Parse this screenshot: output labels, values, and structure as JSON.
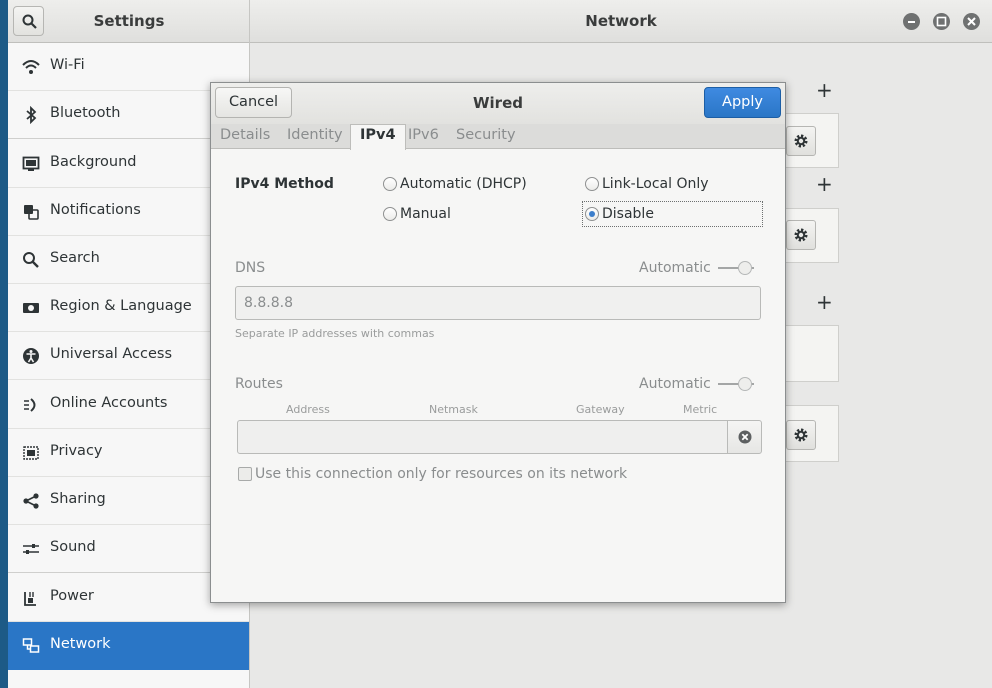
{
  "window": {
    "left_title": "Settings",
    "right_title": "Network"
  },
  "sidebar": {
    "items": [
      {
        "label": "Wi-Fi",
        "icon": "wifi-icon"
      },
      {
        "label": "Bluetooth",
        "icon": "bluetooth-icon"
      },
      {
        "label": "Background",
        "icon": "background-icon"
      },
      {
        "label": "Notifications",
        "icon": "notifications-icon"
      },
      {
        "label": "Search",
        "icon": "search-icon"
      },
      {
        "label": "Region & Language",
        "icon": "region-icon"
      },
      {
        "label": "Universal Access",
        "icon": "universal-access-icon"
      },
      {
        "label": "Online Accounts",
        "icon": "online-accounts-icon"
      },
      {
        "label": "Privacy",
        "icon": "privacy-icon"
      },
      {
        "label": "Sharing",
        "icon": "sharing-icon"
      },
      {
        "label": "Sound",
        "icon": "sound-icon"
      },
      {
        "label": "Power",
        "icon": "power-icon"
      },
      {
        "label": "Network",
        "icon": "network-icon",
        "active": true
      }
    ]
  },
  "dialog": {
    "title": "Wired",
    "cancel_label": "Cancel",
    "apply_label": "Apply",
    "tabs": [
      {
        "label": "Details"
      },
      {
        "label": "Identity"
      },
      {
        "label": "IPv4",
        "active": true
      },
      {
        "label": "IPv6"
      },
      {
        "label": "Security"
      }
    ],
    "ipv4_method_label": "IPv4 Method",
    "methods": {
      "automatic_dhcp": "Automatic (DHCP)",
      "link_local": "Link-Local Only",
      "manual": "Manual",
      "disable": "Disable",
      "selected": "Disable"
    },
    "dns": {
      "label": "DNS",
      "automatic_label": "Automatic",
      "value": "8.8.8.8",
      "hint": "Separate IP addresses with commas"
    },
    "routes": {
      "label": "Routes",
      "automatic_label": "Automatic",
      "columns": [
        "Address",
        "Netmask",
        "Gateway",
        "Metric"
      ]
    },
    "checkbox_label": "Use this connection only for resources on its network"
  },
  "colors": {
    "accent": "#2a76c6",
    "desktop": "#1d5a86"
  }
}
